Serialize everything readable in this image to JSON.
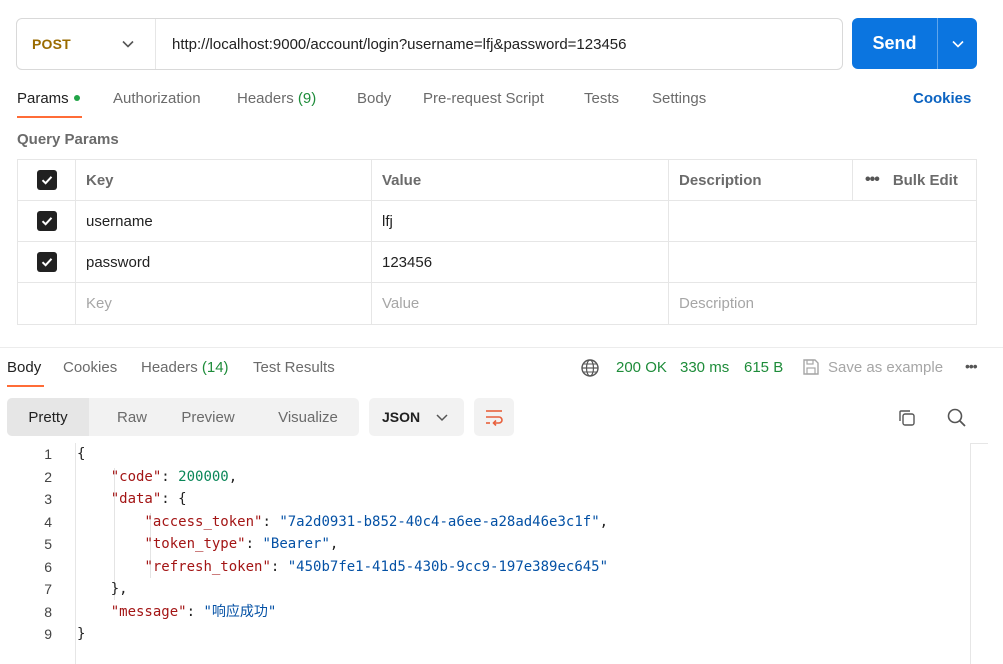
{
  "request": {
    "method": "POST",
    "url": "http://localhost:9000/account/login?username=lfj&password=123456",
    "send_label": "Send"
  },
  "request_tabs": [
    {
      "label": "Params"
    },
    {
      "label": "Authorization"
    },
    {
      "label": "Headers",
      "count": "(9)"
    },
    {
      "label": "Body"
    },
    {
      "label": "Pre-request Script"
    },
    {
      "label": "Tests"
    },
    {
      "label": "Settings"
    }
  ],
  "cookies_link": "Cookies",
  "query_params": {
    "title": "Query Params",
    "headers": {
      "key": "Key",
      "value": "Value",
      "description": "Description",
      "bulk_edit": "Bulk Edit"
    },
    "rows": [
      {
        "key": "username",
        "value": "lfj",
        "description": "",
        "checked": true
      },
      {
        "key": "password",
        "value": "123456",
        "description": "",
        "checked": true
      }
    ],
    "placeholders": {
      "key": "Key",
      "value": "Value",
      "description": "Description"
    }
  },
  "response_tabs": [
    {
      "label": "Body"
    },
    {
      "label": "Cookies"
    },
    {
      "label": "Headers",
      "count": "(14)"
    },
    {
      "label": "Test Results"
    }
  ],
  "response_status": {
    "status": "200 OK",
    "time": "330 ms",
    "size": "615 B",
    "save_label": "Save as example"
  },
  "view_modes": [
    "Pretty",
    "Raw",
    "Preview",
    "Visualize"
  ],
  "format": "JSON",
  "response_body": {
    "line_numbers": [
      "1",
      "2",
      "3",
      "4",
      "5",
      "6",
      "7",
      "8",
      "9"
    ],
    "code": 200000,
    "access_token": "7a2d0931-b852-40c4-a6ee-a28ad46e3c1f",
    "token_type": "Bearer",
    "refresh_token": "450b7fe1-41d5-430b-9cc9-197e389ec645",
    "message": "响应成功"
  },
  "colors": {
    "accent_orange": "#ff6c37",
    "send_blue": "#0b75e0",
    "success_green": "#1e8c3a",
    "method_post": "#9a6b00",
    "link_blue": "#0b63c1"
  }
}
